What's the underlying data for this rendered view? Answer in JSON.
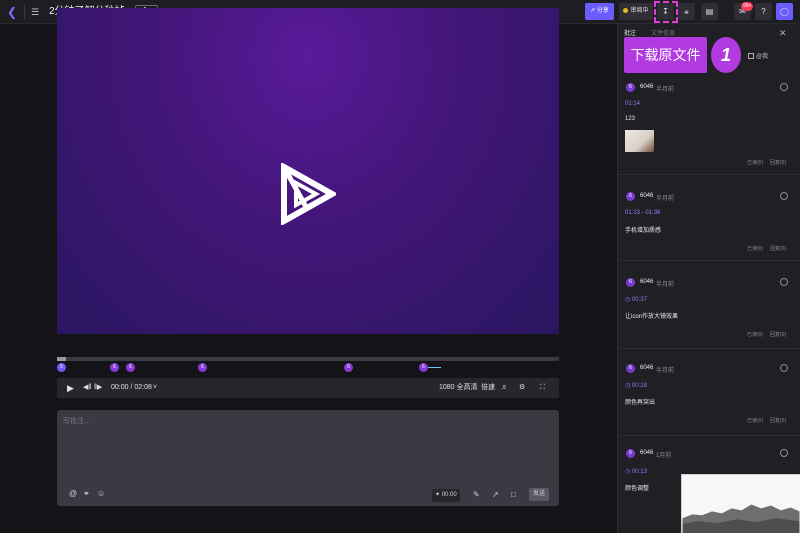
{
  "header": {
    "back_icon": "chevron-left-icon",
    "tree_icon": "folder-tree-icon",
    "title": "2分钟了解分秒帧.mp4",
    "version": "v2",
    "share_label": "分享",
    "review_label": "审阅中",
    "notification_badge": "99+",
    "help_label": "?",
    "accent_color": "#6b5cff",
    "highlight_color": "#e33bd6"
  },
  "callout": {
    "label": "下载原文件",
    "number": "1"
  },
  "player": {
    "timecode": "00:00 / 02:08",
    "quality": "1080 全高清",
    "speed": "倍速",
    "progress": 0.0,
    "markers": [
      "6",
      "6",
      "6",
      "6",
      "6",
      "6"
    ]
  },
  "comment_box": {
    "placeholder": "写批注…",
    "time_label": "00:00",
    "send_label": "发送"
  },
  "panel": {
    "tab_comments": "批注",
    "tab_other": "文件信息",
    "only_me": "@我",
    "close_icon": "close-icon",
    "comments": [
      {
        "avatar": "6",
        "user": "6046",
        "time": "半月前",
        "stamp": "01:14",
        "text": "123",
        "has_thumb": true,
        "read": "已读(0)",
        "reply": "回复(0)"
      },
      {
        "avatar": "6",
        "user": "6046",
        "time": "半月前",
        "stamp": "01:33 - 01:38",
        "text": "手机增加质感",
        "has_thumb": false,
        "read": "已读(0)",
        "reply": "回复(0)"
      },
      {
        "avatar": "6",
        "user": "6046",
        "time": "半月前",
        "stamp": "00:37",
        "text": "让icon作放大镜效果",
        "has_thumb": false,
        "read": "已读(0)",
        "reply": "回复(0)"
      },
      {
        "avatar": "6",
        "user": "6046",
        "time": "半月前",
        "stamp": "00:18",
        "text": "颜色再突出",
        "has_thumb": false,
        "read": "已读(0)",
        "reply": "回复(0)"
      },
      {
        "avatar": "6",
        "user": "6046",
        "time": "1月前",
        "stamp": "00:13",
        "text": "颜色调整",
        "has_thumb": false,
        "read": "",
        "reply": ""
      }
    ]
  }
}
